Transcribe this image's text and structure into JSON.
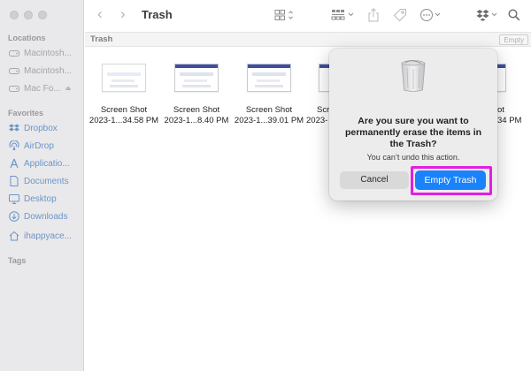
{
  "window": {
    "title": "Trash"
  },
  "toolbar": {
    "back_icon": "chevron-left-icon",
    "forward_icon": "chevron-right-icon",
    "view_icon": "grid-view-icon",
    "group_icon": "group-icon",
    "share_icon": "share-icon",
    "tag_icon": "tag-icon",
    "more_icon": "ellipsis-circle-icon",
    "dropbox_icon": "dropbox-icon",
    "search_icon": "search-icon"
  },
  "sidebar": {
    "locations_header": "Locations",
    "locations": [
      {
        "label": "Macintosh...",
        "icon": "disk-icon",
        "eject": false
      },
      {
        "label": "Macintosh...",
        "icon": "disk-icon",
        "eject": false
      },
      {
        "label": "Mac Fo...",
        "icon": "disk-icon",
        "eject": true
      }
    ],
    "favorites_header": "Favorites",
    "favorites": [
      {
        "label": "Dropbox",
        "icon": "dropbox-icon"
      },
      {
        "label": "AirDrop",
        "icon": "airdrop-icon"
      },
      {
        "label": "Applicatio...",
        "icon": "applications-icon"
      },
      {
        "label": "Documents",
        "icon": "document-icon"
      },
      {
        "label": "Desktop",
        "icon": "desktop-icon"
      },
      {
        "label": "Downloads",
        "icon": "downloads-icon"
      },
      {
        "label": "ihappyace...",
        "icon": "home-icon"
      }
    ],
    "tags_header": "Tags"
  },
  "pathbar": {
    "label": "Trash",
    "empty_button": "Empty"
  },
  "files": [
    {
      "name": "Screen Shot",
      "date": "2023-1...34.58 PM"
    },
    {
      "name": "Screen Shot",
      "date": "2023-1...8.40 PM"
    },
    {
      "name": "Screen Shot",
      "date": "2023-1...39.01 PM"
    },
    {
      "name": "Scr",
      "date": "2023-"
    },
    {
      "name": "ot",
      "date": "34 PM"
    }
  ],
  "dialog": {
    "icon": "trash-can-icon",
    "message": "Are you sure you want to permanently erase the items in the Trash?",
    "info": "You can’t undo this action.",
    "cancel_label": "Cancel",
    "confirm_label": "Empty Trash"
  },
  "colors": {
    "accent": "#1a82fb",
    "highlight": "#e21ee2",
    "sidebar_bg": "#e9e8ea"
  }
}
